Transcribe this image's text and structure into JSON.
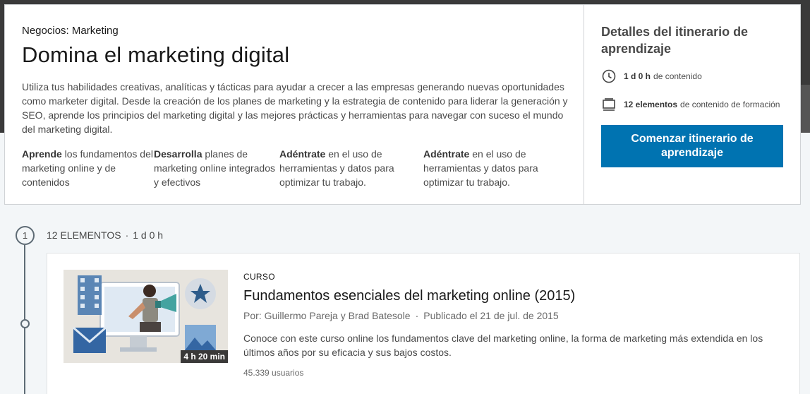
{
  "path": {
    "category_prefix": "Negocios:",
    "category": "Marketing",
    "title": "Domina el marketing digital",
    "description": "Utiliza tus habilidades creativas, analíticas y tácticas para ayudar a crecer a las empresas generando nuevas oportunidades como marketer digital. Desde la creación de los planes de marketing y la estrategia de contenido para liderar la generación y SEO, aprende los principios del marketing digital y las mejores prácticas y herramientas para navegar con suceso el mundo del marketing digital.",
    "skills": [
      {
        "bold": "Aprende",
        "rest": " los fundamentos del marketing online y de contenidos"
      },
      {
        "bold": "Desarrolla",
        "rest": " planes de marketing online integrados y efectivos"
      },
      {
        "bold": "Adéntrate",
        "rest": " en el uso de herramientas y datos para optimizar tu trabajo."
      },
      {
        "bold": "Adéntrate",
        "rest": " en el uso de herramientas y datos para optimizar tu trabajo."
      }
    ]
  },
  "details": {
    "title": "Detalles del itinerario de aprendizaje",
    "duration_bold": "1 d 0 h",
    "duration_rest": "de contenido",
    "items_bold": "12 elementos",
    "items_rest": "de contenido de formación",
    "start_button": "Comenzar itinerario de aprendizaje",
    "icons": {
      "duration": "clock-icon",
      "items": "content-stack-icon"
    }
  },
  "section": {
    "number": "1",
    "count": "12 ELEMENTOS",
    "separator": "·",
    "duration": "1 d 0 h"
  },
  "course": {
    "type": "CURSO",
    "title": "Fundamentos esenciales del marketing online (2015)",
    "authors": "Por: Guillermo Pareja y Brad Batesole",
    "separator": "·",
    "published": "Publicado el 21 de jul. de 2015",
    "description": "Conoce con este curso online los fundamentos clave del marketing online, la forma de marketing más extendida en los últimos años por su eficacia y sus bajos costos.",
    "users": "45.339 usuarios",
    "thumbnail_duration": "4 h 20 min"
  },
  "colors": {
    "accent": "#0073b1",
    "background": "#f3f6f8"
  }
}
